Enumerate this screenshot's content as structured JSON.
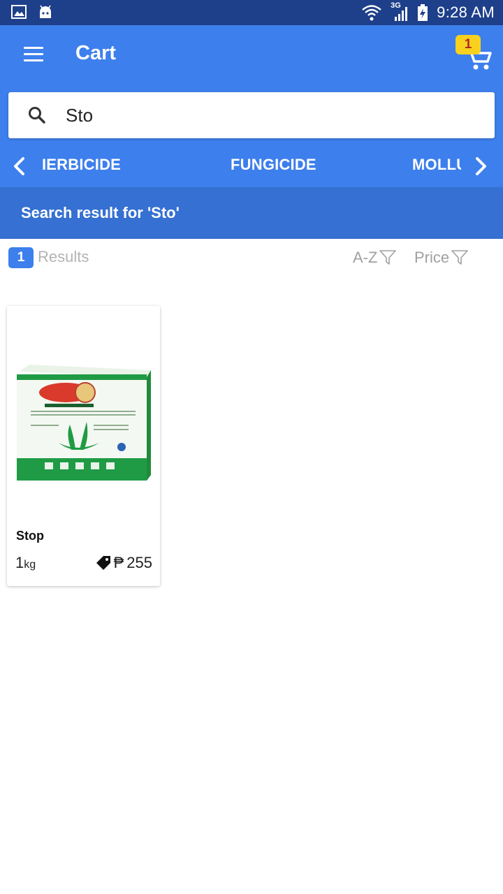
{
  "status_bar": {
    "time": "9:28 AM",
    "network": "3G",
    "icons": [
      "gallery-icon",
      "android-icon",
      "wifi-icon",
      "signal-icon",
      "battery-icon"
    ]
  },
  "app_bar": {
    "title": "Cart",
    "cart_count": "1",
    "icons": [
      "menu-icon",
      "cart-icon"
    ]
  },
  "search": {
    "value": "Sto",
    "icon": "search-icon"
  },
  "categories": {
    "items": [
      "IERBICIDE",
      "FUNGICIDE",
      "MOLLU"
    ],
    "icons": [
      "chevron-left-icon",
      "chevron-right-icon"
    ]
  },
  "result_header": {
    "text": "Search result for 'Sto'"
  },
  "results": {
    "count": "1",
    "label": "Results",
    "sort_az": "A-Z",
    "sort_price": "Price"
  },
  "products": [
    {
      "name": "Stop",
      "qty": "1",
      "unit": "kg",
      "currency": "₱",
      "price": "255"
    }
  ],
  "colors": {
    "status_bar": "#1e3f8a",
    "primary": "#3d7fec",
    "header_dark": "#3570d2",
    "badge_yellow": "#f7d11e",
    "badge_text": "#b4291b"
  }
}
